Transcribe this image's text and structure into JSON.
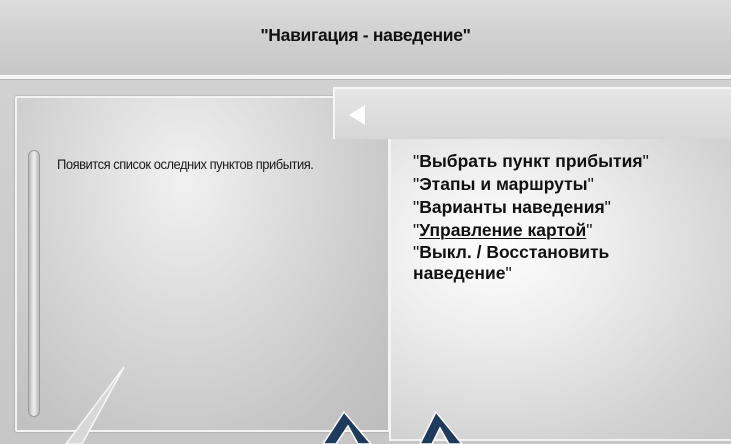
{
  "header": {
    "title": "\"Навигация - наведение\""
  },
  "left_panel": {
    "description": "Появится список оследних пунктов прибытия."
  },
  "right_panel": {
    "back_icon": "triangle-left-icon",
    "menu_items": [
      {
        "label": "Выбрать пункт прибытия"
      },
      {
        "label": "Этапы и маршруты"
      },
      {
        "label": "Варианты наведения"
      },
      {
        "label": "Управление картой"
      },
      {
        "label": "Выкл. / Восстановить наведение"
      }
    ]
  },
  "colors": {
    "arrow_fill": "#1f3a5c",
    "text": "#111111",
    "panel_border": "#f3f3f3"
  }
}
